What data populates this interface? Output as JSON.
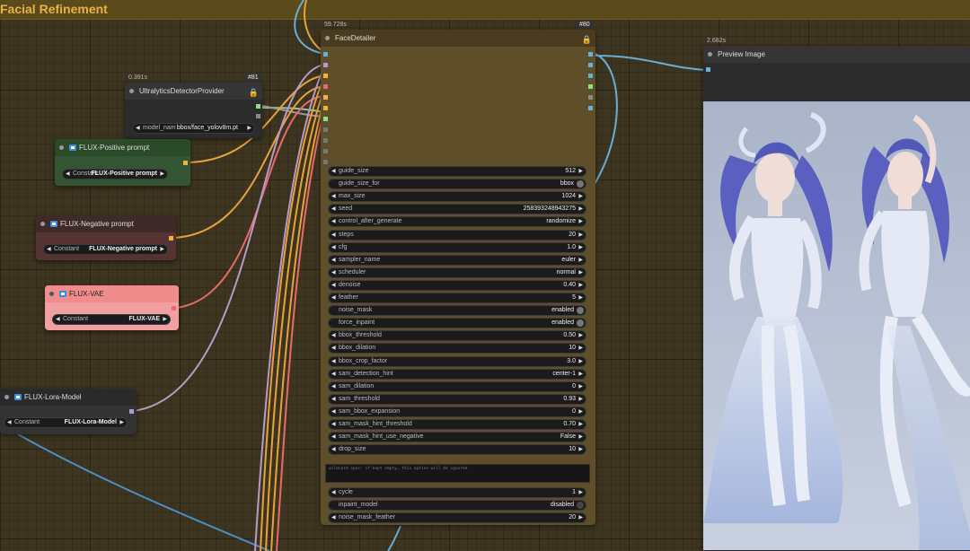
{
  "group": {
    "title": "Facial Refinement"
  },
  "detector": {
    "time": "0.391s",
    "id": "#81",
    "title": "UltralyticsDetectorProvider",
    "widget_label": "model_nam",
    "widget_value": "bbox/face_yolov8m.pt"
  },
  "pos_prompt": {
    "title": "FLUX-Positive prompt",
    "widget_label": "Constant",
    "widget_value": "FLUX-Positive prompt"
  },
  "neg_prompt": {
    "title": "FLUX-Negative prompt",
    "widget_label": "Constant",
    "widget_value": "FLUX-Negative prompt"
  },
  "vae": {
    "title": "FLUX-VAE",
    "widget_label": "Constant",
    "widget_value": "FLUX-VAE"
  },
  "lora": {
    "title": "FLUX-Lora-Model",
    "widget_label": "Constant",
    "widget_value": "FLUX-Lora-Model"
  },
  "face_detailer": {
    "time": "59.728s",
    "id": "#80",
    "title": "FaceDetailer",
    "widgets": [
      {
        "label": "guide_size",
        "value": "512"
      },
      {
        "label": "guide_size_for",
        "value": "bbox"
      },
      {
        "label": "max_size",
        "value": "1024"
      },
      {
        "label": "seed",
        "value": "258393248943275"
      },
      {
        "label": "control_after_generate",
        "value": "randomize"
      },
      {
        "label": "steps",
        "value": "20"
      },
      {
        "label": "cfg",
        "value": "1.0"
      },
      {
        "label": "sampler_name",
        "value": "euler"
      },
      {
        "label": "scheduler",
        "value": "normal"
      },
      {
        "label": "denoise",
        "value": "0.40"
      },
      {
        "label": "feather",
        "value": "5"
      },
      {
        "label": "noise_mask",
        "value": "enabled"
      },
      {
        "label": "force_inpaint",
        "value": "enabled"
      },
      {
        "label": "bbox_threshold",
        "value": "0.50"
      },
      {
        "label": "bbox_dilation",
        "value": "10"
      },
      {
        "label": "bbox_crop_factor",
        "value": "3.0"
      },
      {
        "label": "sam_detection_hint",
        "value": "center-1"
      },
      {
        "label": "sam_dilation",
        "value": "0"
      },
      {
        "label": "sam_threshold",
        "value": "0.93"
      },
      {
        "label": "sam_bbox_expansion",
        "value": "0"
      },
      {
        "label": "sam_mask_hint_threshold",
        "value": "0.70"
      },
      {
        "label": "sam_mask_hint_use_negative",
        "value": "False"
      },
      {
        "label": "drop_size",
        "value": "10"
      }
    ],
    "wildcard_placeholder": "wildcard spec: if kept empty, this option will be ignored",
    "widgets_bottom": [
      {
        "label": "cycle",
        "value": "1"
      },
      {
        "label": "inpaint_model",
        "value": "disabled"
      },
      {
        "label": "noise_mask_feather",
        "value": "20"
      }
    ]
  },
  "preview": {
    "time": "2.682s",
    "title": "Preview Image"
  },
  "colors": {
    "canvas": "#3d3520",
    "accent": "#e7b343"
  }
}
